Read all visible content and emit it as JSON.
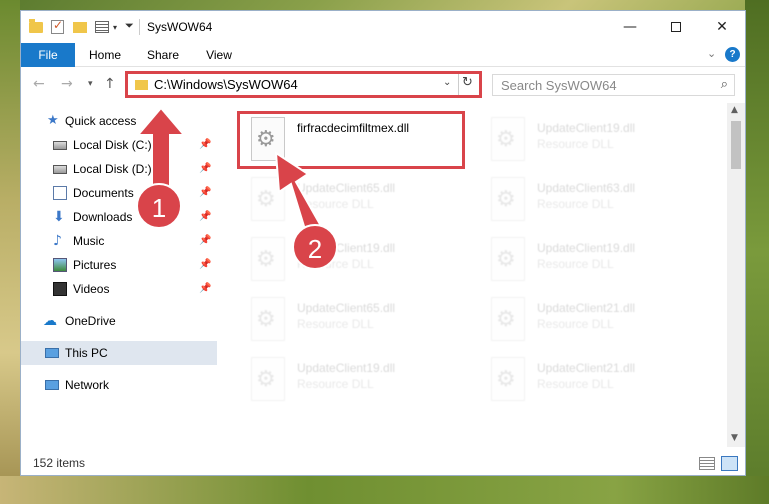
{
  "window": {
    "title": "SysWOW64",
    "controls": {
      "minimize": "—",
      "maximize": "",
      "close": "✕"
    }
  },
  "ribbon": {
    "tabs": [
      "File",
      "Home",
      "Share",
      "View"
    ],
    "help_label": "?"
  },
  "nav": {
    "address": "C:\\Windows\\SysWOW64",
    "search_placeholder": "Search SysWOW64"
  },
  "sidebar": {
    "items": [
      {
        "label": "Quick access",
        "icon": "star-icon",
        "pinned": false
      },
      {
        "label": "Local Disk (C:)",
        "icon": "drive-icon",
        "pinned": true
      },
      {
        "label": "Local Disk (D:)",
        "icon": "drive-icon",
        "pinned": true
      },
      {
        "label": "Documents",
        "icon": "documents-icon",
        "pinned": true
      },
      {
        "label": "Downloads",
        "icon": "download-icon",
        "pinned": true
      },
      {
        "label": "Music",
        "icon": "music-icon",
        "pinned": true
      },
      {
        "label": "Pictures",
        "icon": "pictures-icon",
        "pinned": true
      },
      {
        "label": "Videos",
        "icon": "videos-icon",
        "pinned": true
      },
      {
        "label": "OneDrive",
        "icon": "cloud-icon",
        "pinned": false
      },
      {
        "label": "This PC",
        "icon": "computer-icon",
        "pinned": false,
        "selected": true
      },
      {
        "label": "Network",
        "icon": "network-icon",
        "pinned": false
      }
    ]
  },
  "files": [
    {
      "name": "firfracdecimfiltmex.dll",
      "type": "",
      "highlighted": true
    },
    {
      "name": "UpdateClient19.dll",
      "type": "Resource DLL"
    },
    {
      "name": "UpdateClient65.dll",
      "type": "Resource DLL"
    },
    {
      "name": "UpdateClient63.dll",
      "type": "Resource DLL"
    },
    {
      "name": "UpdateClient19.dll",
      "type": "Resource DLL"
    },
    {
      "name": "UpdateClient19.dll",
      "type": "Resource DLL"
    },
    {
      "name": "UpdateClient65.dll",
      "type": "Resource DLL"
    },
    {
      "name": "UpdateClient21.dll",
      "type": "Resource DLL"
    },
    {
      "name": "UpdateClient19.dll",
      "type": "Resource DLL"
    },
    {
      "name": "UpdateClient21.dll",
      "type": "Resource DLL"
    }
  ],
  "status": {
    "item_count": "152 items"
  },
  "annotations": {
    "step1": "1",
    "step2": "2",
    "color": "#d9444a"
  }
}
